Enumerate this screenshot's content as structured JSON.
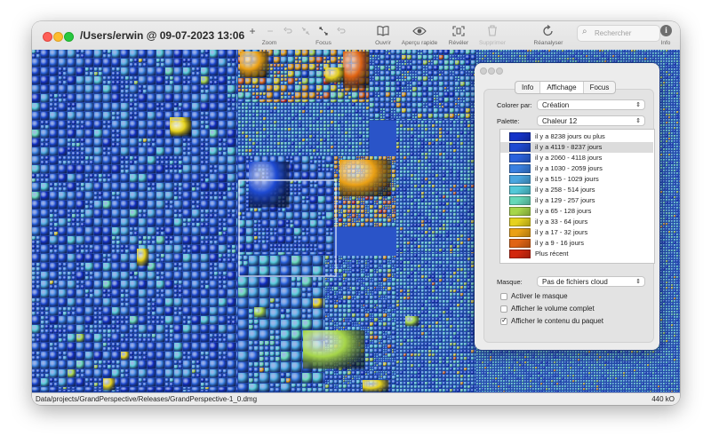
{
  "window": {
    "title": "/Users/erwin @ 09-07-2023 13:06"
  },
  "toolbar": {
    "zoom_in_glyph": "+",
    "zoom_out_glyph": "−",
    "zoom_label": "Zoom",
    "focus_label": "Focus",
    "open_label": "Ouvrir",
    "quicklook_label": "Aperçu rapide",
    "reveal_label": "Révéler",
    "delete_label": "Supprimer",
    "rescan_label": "Réanalyser",
    "info_label": "Info",
    "search_placeholder": "Rechercher",
    "icons": {
      "zoom_in": "plus-icon",
      "zoom_out": "minus-icon",
      "zoom_reset": "undo-icon",
      "focus_out": "shrink-icon",
      "focus_in": "expand-icon",
      "focus_reset": "undo-icon",
      "open": "book-icon",
      "quicklook": "eye-icon",
      "reveal": "reveal-icon",
      "delete": "trash-icon",
      "rescan": "refresh-icon",
      "info": "info-icon",
      "search": "magnifier-icon"
    }
  },
  "statusbar": {
    "path": "Data/projects/GrandPerspective/Releases/GrandPerspective-1_0.dmg",
    "size": "440 kO"
  },
  "panel": {
    "tabs": [
      {
        "label": "Info"
      },
      {
        "label": "Affichage"
      },
      {
        "label": "Focus"
      }
    ],
    "active_tab": "Affichage",
    "color_by_label": "Colorer par:",
    "color_by_value": "Création",
    "palette_label": "Palette:",
    "palette_value": "Chaleur 12",
    "legend": [
      {
        "label": "il y a 8238 jours ou plus",
        "color": "#1432c8"
      },
      {
        "label": "il y a 4119 - 8237 jours",
        "color": "#1e4ad2"
      },
      {
        "label": "il y a 2060 - 4118 jours",
        "color": "#2a62dc"
      },
      {
        "label": "il y a 1030 - 2059 jours",
        "color": "#3a80e0"
      },
      {
        "label": "il y a 515 - 1029 jours",
        "color": "#4aa6e0"
      },
      {
        "label": "il y a 258 - 514 jours",
        "color": "#52c8d8"
      },
      {
        "label": "il y a 129 - 257 jours",
        "color": "#66d8b8"
      },
      {
        "label": "il y a 65 - 128 jours",
        "color": "#a6d64a"
      },
      {
        "label": "il y a 33 - 64 jours",
        "color": "#e6d21e"
      },
      {
        "label": "il y a 17 - 32 jours",
        "color": "#eaa014"
      },
      {
        "label": "il y a 9 - 16 jours",
        "color": "#e06414"
      },
      {
        "label": "Plus récent",
        "color": "#d2280e"
      }
    ],
    "selected_legend_index": 1,
    "mask_label": "Masque:",
    "mask_value": "Pas de fichiers cloud",
    "checkboxes": [
      {
        "label": "Activer le masque",
        "checked": false
      },
      {
        "label": "Afficher le volume complet",
        "checked": false
      },
      {
        "label": "Afficher le contenu du paquet",
        "checked": true
      }
    ]
  },
  "colors": {
    "treemap_dark_blue": "#1a3cc8",
    "treemap_mid_blue": "#3a7ee0",
    "treemap_cyan": "#5ac8d8",
    "treemap_orange": "#e69a14",
    "treemap_yellow": "#e6d21e",
    "treemap_green": "#a6d64a"
  }
}
